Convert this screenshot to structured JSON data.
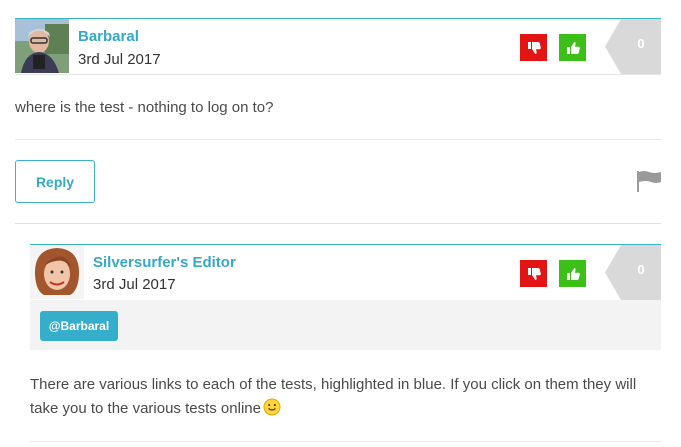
{
  "comments": [
    {
      "author": "Barbaral",
      "date": "3rd Jul 2017",
      "score": "0",
      "text": "where is the test - nothing to log on to?",
      "reply_label": "Reply"
    },
    {
      "author": "Silversurfer's Editor",
      "date": "3rd Jul 2017",
      "score": "0",
      "mention": "@Barbaral",
      "text": "There are various links to each of the tests, highlighted in blue. If you click on them they will take you to the various tests online"
    }
  ],
  "colors": {
    "accent": "#3bb0c9",
    "downvote": "#e31414",
    "upvote": "#3cbf16",
    "score_bg": "#d9d9d9"
  },
  "icons": [
    "thumbs-down-icon",
    "thumbs-up-icon",
    "flag-icon",
    "smiley-icon"
  ]
}
